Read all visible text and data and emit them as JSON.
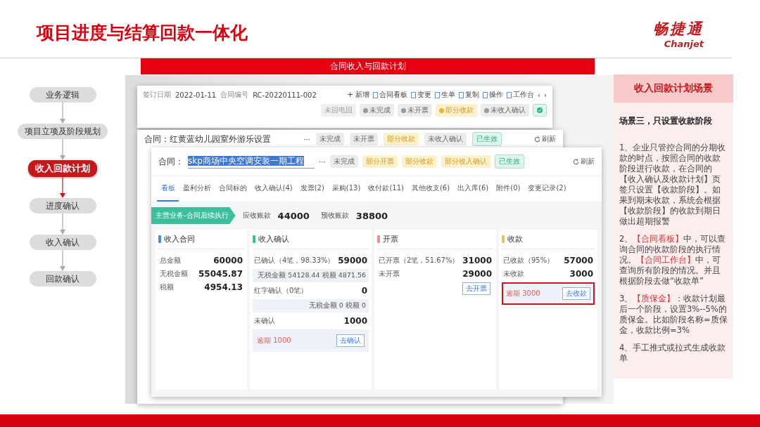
{
  "slide": {
    "title": "项目进度与结算回款一体化",
    "logo_cn": "畅捷通",
    "logo_en": "Chanjet"
  },
  "flow": [
    {
      "label": "业务逻辑",
      "selected": false
    },
    {
      "label": "项目立项及阶段规划",
      "selected": false
    },
    {
      "label": "收入回款计划",
      "selected": true
    },
    {
      "label": "进度确认",
      "selected": false
    },
    {
      "label": "收入确认",
      "selected": false
    },
    {
      "label": "回款确认",
      "selected": false
    }
  ],
  "banner": "合同收入与回款计划",
  "back_window": {
    "date_label": "签订日期",
    "date": "2022-01-11",
    "number_label": "合同编号",
    "number": "RC-20220111-002",
    "toolbar": [
      {
        "label": "+ 新增",
        "kind": "text"
      },
      {
        "label": "合同看板",
        "kind": "icon"
      },
      {
        "label": "变更",
        "kind": "icon"
      },
      {
        "label": "生单",
        "kind": "icon"
      },
      {
        "label": "复制",
        "kind": "icon"
      },
      {
        "label": "操作",
        "kind": "icon"
      },
      {
        "label": "工作台",
        "kind": "icon"
      }
    ],
    "nav": [
      "‹",
      "›"
    ],
    "tags": [
      {
        "label": "未回电回",
        "kind": "plain"
      },
      {
        "label": "未完成",
        "kind": "neutral"
      },
      {
        "label": "未开票",
        "kind": "neutral"
      },
      {
        "label": "部分收款",
        "kind": "partial"
      },
      {
        "label": "未收入确认",
        "kind": "neutral"
      },
      {
        "kind": "done"
      }
    ]
  },
  "middle_window": {
    "title_label": "合同：",
    "title": "红黄蓝幼儿园室外游乐设置",
    "more": "···",
    "refresh": "刷新",
    "tags": [
      {
        "label": "未完成",
        "kind": "neutral"
      },
      {
        "label": "未开票",
        "kind": "neutral"
      },
      {
        "label": "部分收款",
        "kind": "partial"
      },
      {
        "label": "未收入确认",
        "kind": "neutral"
      },
      {
        "label": "已生效",
        "kind": "done"
      }
    ]
  },
  "front_window": {
    "title_label": "合同：",
    "title": "skp商场中央空调安装一期工程",
    "more": "···",
    "refresh": "刷新",
    "tags": [
      {
        "label": "未完成",
        "kind": "neutral"
      },
      {
        "label": "部分开票",
        "kind": "partial"
      },
      {
        "label": "部分收款",
        "kind": "partial"
      },
      {
        "label": "部分收入确认",
        "kind": "partial"
      },
      {
        "label": "已生效",
        "kind": "done"
      }
    ],
    "tabs": [
      {
        "label": "看板",
        "selected": true
      },
      {
        "label": "盈利分析",
        "selected": false
      },
      {
        "label": "合同标的",
        "selected": false
      },
      {
        "label": "收入确认(4)",
        "selected": false
      },
      {
        "label": "发票(2)",
        "selected": false
      },
      {
        "label": "采购(13)",
        "selected": false
      },
      {
        "label": "收付款(11)",
        "selected": false
      },
      {
        "label": "其他收支(6)",
        "selected": false
      },
      {
        "label": "出入库(6)",
        "selected": false
      },
      {
        "label": "附件(0)",
        "selected": false
      },
      {
        "label": "变更记录(2)",
        "selected": false
      }
    ],
    "stage_badge": "主营业务-合同后续执行",
    "receivables": [
      {
        "label": "应收账款",
        "value": "44000"
      },
      {
        "label": "预收账款",
        "value": "38800"
      }
    ],
    "cards": [
      {
        "title": "收入合同",
        "color": "#4a8fd8",
        "items": [
          {
            "kind": "row",
            "label": "总金额",
            "value": "60000"
          },
          {
            "kind": "row",
            "label": "无税金额",
            "value": "55045.87"
          },
          {
            "kind": "row",
            "label": "税额",
            "value": "4954.13"
          }
        ]
      },
      {
        "title": "收入确认",
        "color": "#3cbf9c",
        "items": [
          {
            "kind": "row",
            "label": "已确认（4笔，98.33%）",
            "value": "59000"
          },
          {
            "kind": "sub",
            "text": "无税金额 54128.44 税额 4871.56"
          },
          {
            "kind": "row",
            "label": "红字确认（0笔）",
            "value": "0"
          },
          {
            "kind": "sub",
            "text": "无税金额 0 税额 0"
          },
          {
            "kind": "row",
            "label": "未确认",
            "value": "1000"
          },
          {
            "kind": "overdue",
            "text": "逾期 1000",
            "button": "去确认",
            "highlighted": false
          }
        ]
      },
      {
        "title": "开票",
        "color": "#e8958a",
        "items": [
          {
            "kind": "row",
            "label": "已开票（2笔，51.67%）",
            "value": "31000"
          },
          {
            "kind": "row",
            "label": "未开票",
            "value": "29000"
          },
          {
            "kind": "action",
            "button": "去开票"
          }
        ]
      },
      {
        "title": "收款",
        "color": "#e6c65a",
        "items": [
          {
            "kind": "row",
            "label": "已收款（95%）",
            "value": "57000"
          },
          {
            "kind": "row",
            "label": "未收款",
            "value": "3000"
          },
          {
            "kind": "overdue",
            "text": "逾期 3000",
            "button": "去收款",
            "highlighted": true
          }
        ]
      }
    ]
  },
  "scenario": {
    "title": "收入回款计划场景",
    "subtitle": "场景三，只设置收款阶段",
    "paragraphs": [
      [
        {
          "text": "1、企业只管控合同的分期收款的时点，按照合同的收款阶段进行收款，在合同的【收入确认及收款计划】页签只设置【收款阶段】。如果到期未收款，系统会根据【收款阶段】的收款到期日做出超期报警",
          "highlight": false
        }
      ],
      [
        {
          "text": "2、",
          "highlight": false
        },
        {
          "text": "【合同看板】",
          "highlight": true
        },
        {
          "text": "中，可以查询合同的收款阶段的执行情况。",
          "highlight": false
        },
        {
          "text": "【合同工作台】",
          "highlight": true
        },
        {
          "text": "中，可查询所有阶段的情况。并且根据阶段去做“收款单”",
          "highlight": false
        }
      ],
      [
        {
          "text": "3、",
          "highlight": false
        },
        {
          "text": "【质保金】",
          "highlight": true
        },
        {
          "text": "：收款计划最后一个阶段，设置3%--5%的质保金。比如阶段名称=质保金，收款比例=3%",
          "highlight": false
        }
      ],
      [
        {
          "text": "4、手工推式或拉式生成收款单",
          "highlight": false
        }
      ]
    ]
  }
}
